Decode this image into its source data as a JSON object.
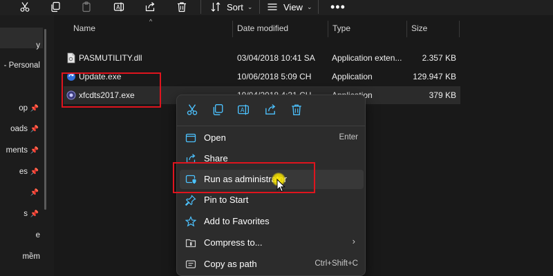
{
  "toolbar": {
    "sort_label": "Sort",
    "view_label": "View",
    "more_label": "•••"
  },
  "nav": {
    "items": [
      {
        "label": "y",
        "pinned": false
      },
      {
        "label": "- Personal",
        "pinned": false
      },
      {
        "label": "op",
        "pinned": true
      },
      {
        "label": "oads",
        "pinned": true
      },
      {
        "label": "ments",
        "pinned": true
      },
      {
        "label": "es",
        "pinned": true
      },
      {
        "label": "",
        "pinned": true
      },
      {
        "label": "s",
        "pinned": true
      },
      {
        "label": "e",
        "pinned": false
      },
      {
        "label": "mềm",
        "pinned": false
      }
    ],
    "pin_glyph": "📌"
  },
  "columns": {
    "name": "Name",
    "date": "Date modified",
    "type": "Type",
    "size": "Size"
  },
  "files": [
    {
      "name": "PASMUTILITY.dll",
      "date": "03/04/2018 10:41 SA",
      "type": "Application exten...",
      "size": "2.357 KB",
      "icon": "dll-file-icon",
      "selected": false
    },
    {
      "name": "Update.exe",
      "date": "10/06/2018 5:09 CH",
      "type": "Application",
      "size": "129.947 KB",
      "icon": "update-exe-icon",
      "selected": false
    },
    {
      "name": "xfcdts2017.exe",
      "date": "19/04/2018 4:31 CH",
      "type": "Application",
      "size": "379 KB",
      "icon": "xfcdts-exe-icon",
      "selected": true
    }
  ],
  "context_menu": {
    "quick_actions": [
      "cut-icon",
      "copy-icon",
      "rename-icon",
      "share-icon",
      "delete-icon"
    ],
    "items": [
      {
        "label": "Open",
        "shortcut": "Enter",
        "icon": "open-app-icon",
        "submenu": false,
        "hover": false
      },
      {
        "label": "Share",
        "shortcut": "",
        "icon": "share-icon",
        "submenu": false,
        "hover": false
      },
      {
        "label": "Run as administrator",
        "shortcut": "",
        "icon": "shield-admin-icon",
        "submenu": false,
        "hover": true
      },
      {
        "label": "Pin to Start",
        "shortcut": "",
        "icon": "pin-icon",
        "submenu": false,
        "hover": false
      },
      {
        "label": "Add to Favorites",
        "shortcut": "",
        "icon": "star-icon",
        "submenu": false,
        "hover": false
      },
      {
        "label": "Compress to...",
        "shortcut": "",
        "icon": "zip-folder-icon",
        "submenu": true,
        "hover": false
      },
      {
        "label": "Copy as path",
        "shortcut": "Ctrl+Shift+C",
        "icon": "copy-path-icon",
        "submenu": false,
        "hover": false
      }
    ],
    "submenu_glyph": "›"
  },
  "colors": {
    "accent_blue": "#4cc2ff",
    "highlight_red": "#e0141e",
    "background": "#191919",
    "menu_bg": "#2c2c2c"
  }
}
